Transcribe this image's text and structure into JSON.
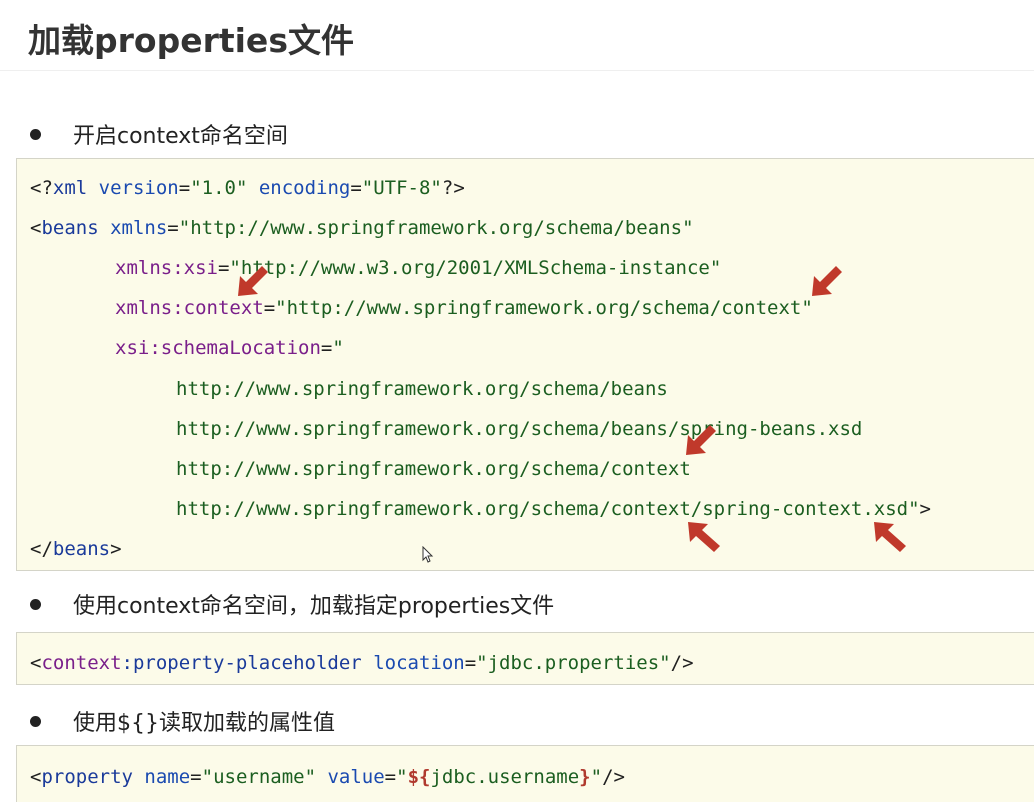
{
  "title": "加载properties文件",
  "bullets": [
    "开启context命名空间",
    "使用context命名空间，加载指定properties文件",
    "使用${}读取加载的属性值"
  ],
  "code1": {
    "l1": {
      "p1": "<?",
      "t1": "xml",
      "a1": " version",
      "e1": "=",
      "s1": "\"1.0\"",
      "a2": " encoding",
      "e2": "=",
      "s2": "\"UTF-8\"",
      "p2": "?>"
    },
    "l2": {
      "p1": "<",
      "t1": "beans",
      "a1": " xmlns",
      "e1": "=",
      "s1": "\"http://www.springframework.org/schema/beans\""
    },
    "l3": {
      "n1": "xmlns:xsi",
      "e1": "=",
      "s1": "\"http://www.w3.org/2001/XMLSchema-instance\""
    },
    "l4": {
      "n1": "xmlns:context",
      "e1": "=",
      "s1": "\"http://www.springframework.org/schema/context\""
    },
    "l5": {
      "n1": "xsi:schemaLocation",
      "e1": "=",
      "s1": "\""
    },
    "l6": "http://www.springframework.org/schema/beans",
    "l7": "http://www.springframework.org/schema/beans/spring-beans.xsd",
    "l8": "http://www.springframework.org/schema/context",
    "l9": {
      "s1": "http://www.springframework.org/schema/context/spring-context.xsd\"",
      "p1": ">"
    },
    "l10": {
      "p1": "</",
      "t1": "beans",
      "p2": ">"
    }
  },
  "code2": {
    "p1": "<",
    "n1": "context",
    "n2": ":property-placeholder",
    "a1": " location",
    "e1": "=",
    "s1": "\"jdbc.properties\"",
    "p2": "/>"
  },
  "code3": {
    "p1": "<",
    "t1": "property",
    "a1": " name",
    "e1": "=",
    "s1": "\"username\"",
    "a2": " value",
    "e2": "=",
    "s2": "\"",
    "el": "${",
    "s3": "jdbc.username",
    "el2": "}",
    "s4": "\"",
    "p2": "/>"
  },
  "colors": {
    "arrow": "#c0392b",
    "code_bg": "#fcfbe9"
  }
}
